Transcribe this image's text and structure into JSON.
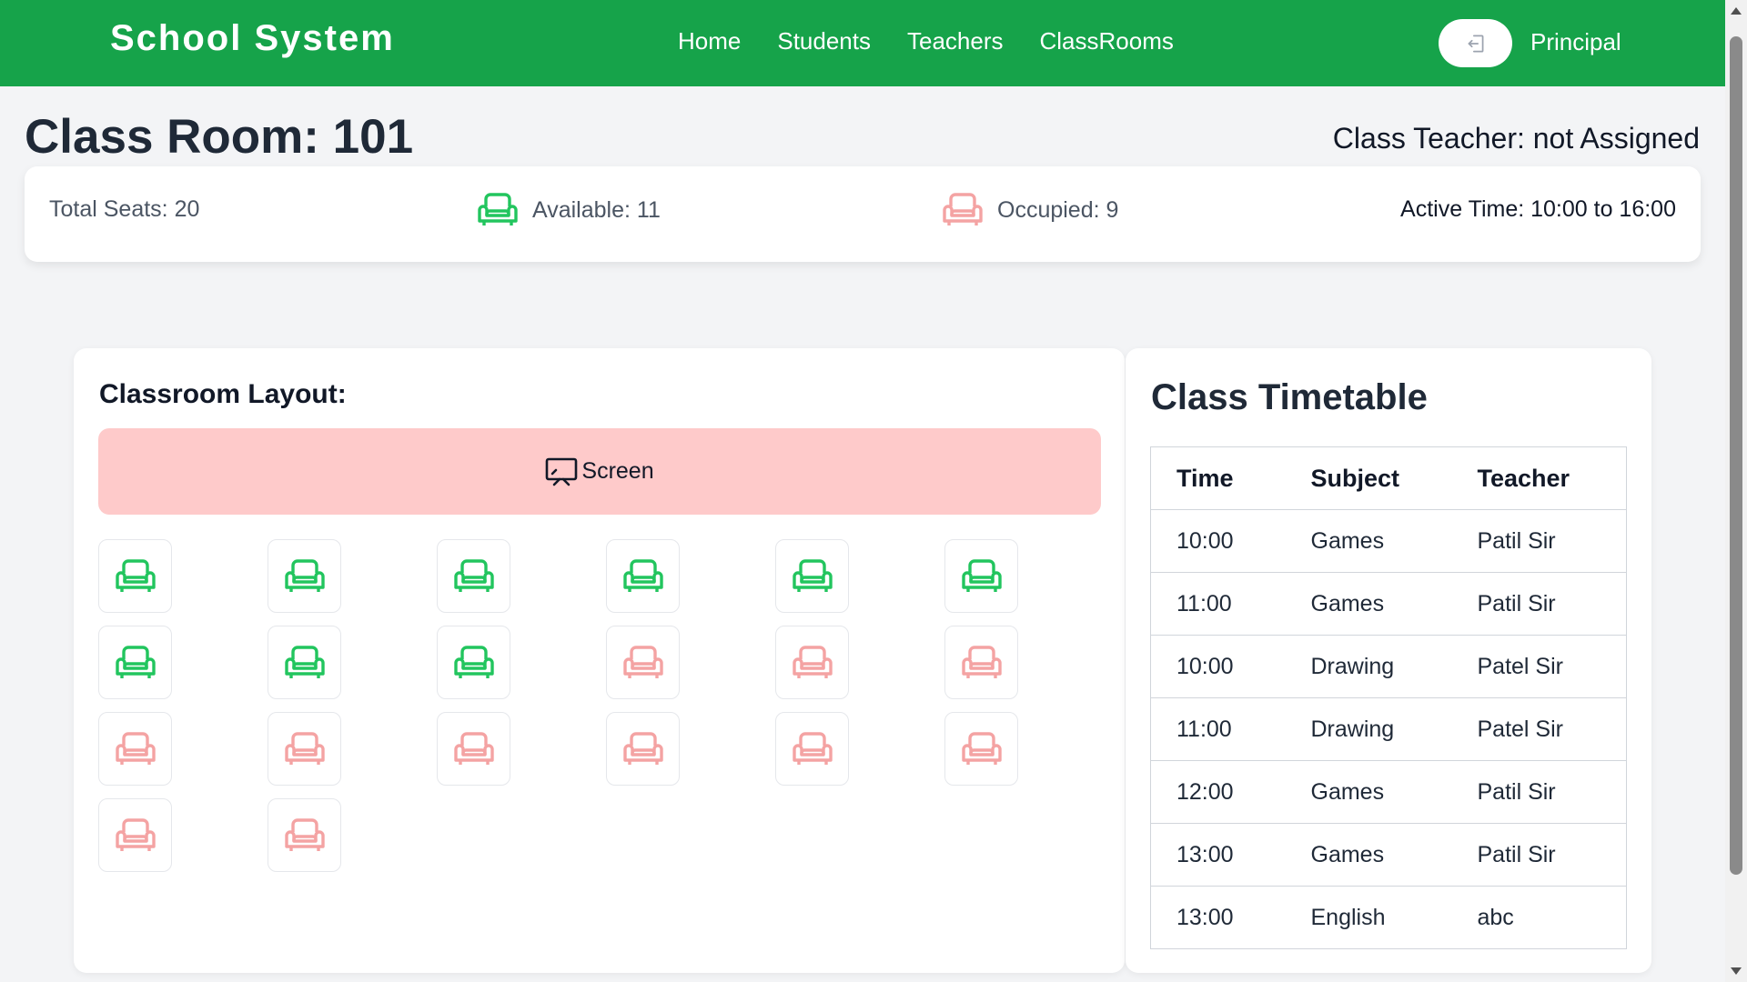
{
  "navbar": {
    "brand": "School System",
    "links": [
      "Home",
      "Students",
      "Teachers",
      "ClassRooms"
    ],
    "role": "Principal",
    "logout_icon": "logout-icon"
  },
  "header": {
    "title": "Class Room: 101",
    "class_teacher": "Class Teacher: not Assigned"
  },
  "stats": {
    "total": "Total Seats: 20",
    "available": "Available: 11",
    "occupied": "Occupied: 9",
    "active_time": "Active Time: 10:00 to 16:00"
  },
  "layout": {
    "title": "Classroom Layout:",
    "screen_label": "Screen",
    "seats": [
      "available",
      "available",
      "available",
      "available",
      "available",
      "available",
      "available",
      "available",
      "available",
      "occupied",
      "occupied",
      "occupied",
      "occupied",
      "occupied",
      "occupied",
      "occupied",
      "occupied",
      "occupied",
      "occupied",
      "occupied"
    ]
  },
  "timetable": {
    "title": "Class Timetable",
    "headers": [
      "Time",
      "Subject",
      "Teacher"
    ],
    "rows": [
      [
        "10:00",
        "Games",
        "Patil Sir"
      ],
      [
        "11:00",
        "Games",
        "Patil Sir"
      ],
      [
        "10:00",
        "Drawing",
        "Patel Sir"
      ],
      [
        "11:00",
        "Drawing",
        "Patel Sir"
      ],
      [
        "12:00",
        "Games",
        "Patil Sir"
      ],
      [
        "13:00",
        "Games",
        "Patil Sir"
      ],
      [
        "13:00",
        "English",
        "abc"
      ]
    ]
  },
  "colors": {
    "brand_green": "#16a34a",
    "available": "#22c55e",
    "occupied": "#f4a3a3",
    "screen_bg": "#fecaca"
  }
}
